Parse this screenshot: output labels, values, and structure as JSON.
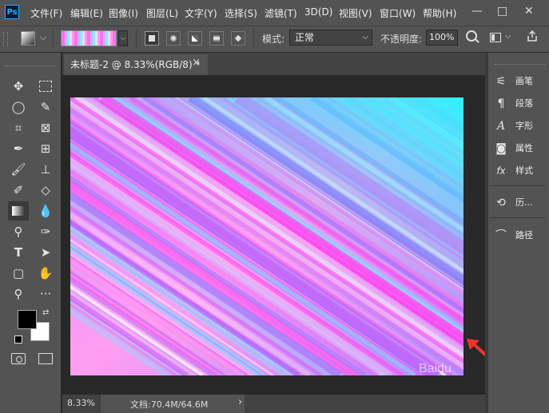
{
  "app": {
    "logo_text": "Ps"
  },
  "menu": [
    "文件(F)",
    "编辑(E)",
    "图像(I)",
    "图层(L)",
    "文字(Y)",
    "选择(S)",
    "滤镜(T)",
    "3D(D)",
    "视图(V)",
    "窗口(W)",
    "帮助(H)"
  ],
  "window_controls": {
    "minimize": "—",
    "maximize": "□",
    "close": "✕"
  },
  "options": {
    "mode_label": "模式:",
    "mode_value": "正常",
    "opacity_label": "不透明度:",
    "opacity_value": "100%"
  },
  "document": {
    "tab_title": "未标题-2 @ 8.33%(RGB/8) *",
    "tab_close": "×"
  },
  "status": {
    "zoom": "8.33%",
    "doc_info": "文档:70.4M/64.6M",
    "arrow": "›"
  },
  "panels": {
    "collapse_left": "«",
    "collapse_right": "«",
    "items": [
      {
        "label": "画笔",
        "icon": "brush-settings-icon"
      },
      {
        "label": "段落",
        "icon": "paragraph-icon"
      },
      {
        "label": "字形",
        "icon": "glyphs-icon"
      },
      {
        "label": "属性",
        "icon": "properties-icon"
      },
      {
        "label": "样式",
        "icon": "styles-icon"
      },
      {
        "label": "历...",
        "icon": "history-icon"
      },
      {
        "label": "路径",
        "icon": "paths-icon"
      }
    ]
  },
  "colors": {
    "foreground": "#000000",
    "background": "#ffffff",
    "accent_arrow": "#e8382b"
  },
  "watermark": "Baidu"
}
